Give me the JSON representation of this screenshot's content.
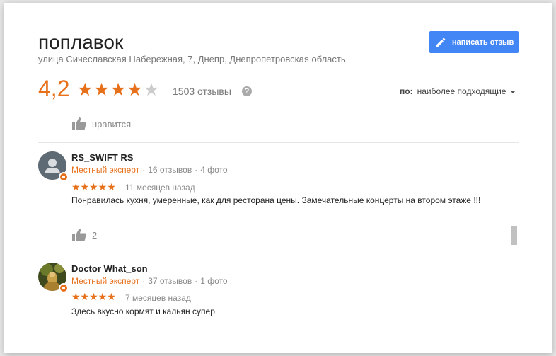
{
  "place": {
    "title": "поплавок",
    "address": "улица Сичеславская Набережная, 7, Днепр, Днепропетровская область"
  },
  "write_review_label": "написать отзыв",
  "rating": {
    "value": "4,2",
    "stars": 4,
    "max": 5,
    "reviews_count": "1503 отзывы"
  },
  "sort": {
    "label": "по:",
    "value": "наиболее подходящие"
  },
  "top_like": {
    "label": "нравится"
  },
  "reviews": [
    {
      "author": "RS_SWIFT RS",
      "badge": "Местный эксперт",
      "reviews": "16 отзывов",
      "photos": "4 фото",
      "stars": "★★★★★",
      "date": "11 месяцев назад",
      "text": "Понравилась кухня, умеренные, как для ресторана цены. Замечательные концерты на втором этаже !!!",
      "likes": "2"
    },
    {
      "author": "Doctor What_son",
      "badge": "Местный эксперт",
      "reviews": "37 отзывов",
      "photos": "1 фото",
      "stars": "★★★★★",
      "date": "7 месяцев назад",
      "text": "Здесь вкусно кормят и кальян супер"
    }
  ],
  "colors": {
    "accent": "#e7711b",
    "button": "#4285f4"
  }
}
